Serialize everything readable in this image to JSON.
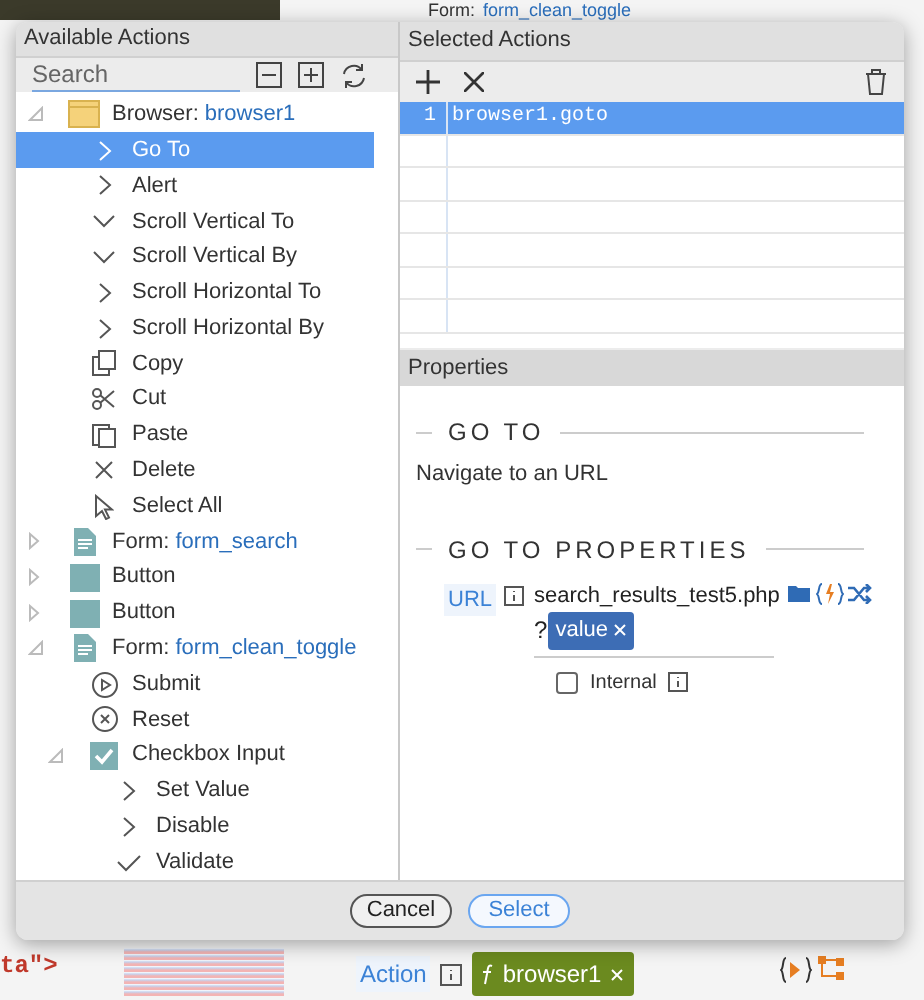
{
  "background": {
    "form_label": "Form:",
    "form_name": "form_clean_toggle",
    "code_fragment": "ta\">",
    "action_label": "Action",
    "action_chip": "browser1"
  },
  "dialog": {
    "available": {
      "title": "Available Actions",
      "search": {
        "placeholder": "Search"
      },
      "tree": [
        {
          "kind": "browser",
          "label": "Browser:",
          "name": "browser1",
          "expanded": true,
          "selected": false,
          "children": [
            {
              "kind": "chevron",
              "label": "Go To",
              "selected": true
            },
            {
              "kind": "chevron",
              "label": "Alert",
              "selected": false
            },
            {
              "kind": "chevron-down",
              "label": "Scroll Vertical To",
              "selected": false
            },
            {
              "kind": "chevron-down",
              "label": "Scroll Vertical By",
              "selected": false
            },
            {
              "kind": "chevron",
              "label": "Scroll Horizontal To",
              "selected": false
            },
            {
              "kind": "chevron",
              "label": "Scroll Horizontal By",
              "selected": false
            },
            {
              "kind": "copy",
              "label": "Copy",
              "selected": false
            },
            {
              "kind": "cut",
              "label": "Cut",
              "selected": false
            },
            {
              "kind": "paste",
              "label": "Paste",
              "selected": false
            },
            {
              "kind": "delete",
              "label": "Delete",
              "selected": false
            },
            {
              "kind": "cursor",
              "label": "Select All",
              "selected": false
            }
          ]
        },
        {
          "kind": "form",
          "label": "Form:",
          "name": "form_search",
          "expanded": false,
          "selected": false
        },
        {
          "kind": "button",
          "label": "Button",
          "expanded": false,
          "selected": false
        },
        {
          "kind": "button",
          "label": "Button",
          "expanded": false,
          "selected": false
        },
        {
          "kind": "form",
          "label": "Form:",
          "name": "form_clean_toggle",
          "expanded": true,
          "selected": false,
          "children": [
            {
              "kind": "submit",
              "label": "Submit",
              "selected": false
            },
            {
              "kind": "reset",
              "label": "Reset",
              "selected": false
            },
            {
              "kind": "checkbox",
              "label": "Checkbox Input",
              "expanded": true,
              "selected": false,
              "children": [
                {
                  "kind": "chevron",
                  "label": "Set Value",
                  "selected": false
                },
                {
                  "kind": "chevron",
                  "label": "Disable",
                  "selected": false
                },
                {
                  "kind": "check",
                  "label": "Validate",
                  "selected": false
                }
              ]
            }
          ]
        }
      ]
    },
    "selected_actions": {
      "title": "Selected Actions",
      "rows": [
        {
          "number": "1",
          "action": "browser1.goto",
          "selected": true
        }
      ]
    },
    "properties": {
      "title": "Properties",
      "section_title": "GO TO",
      "description": "Navigate to an URL",
      "properties_title": "GO TO PROPERTIES",
      "url_label": "URL",
      "url_value": "search_results_test5.php",
      "query_prefix": "?",
      "query_chip": "value",
      "internal": {
        "label": "Internal",
        "checked": false
      }
    },
    "buttons": [
      {
        "label": "Cancel",
        "kind": "secondary"
      },
      {
        "label": "Select",
        "kind": "primary"
      }
    ]
  }
}
